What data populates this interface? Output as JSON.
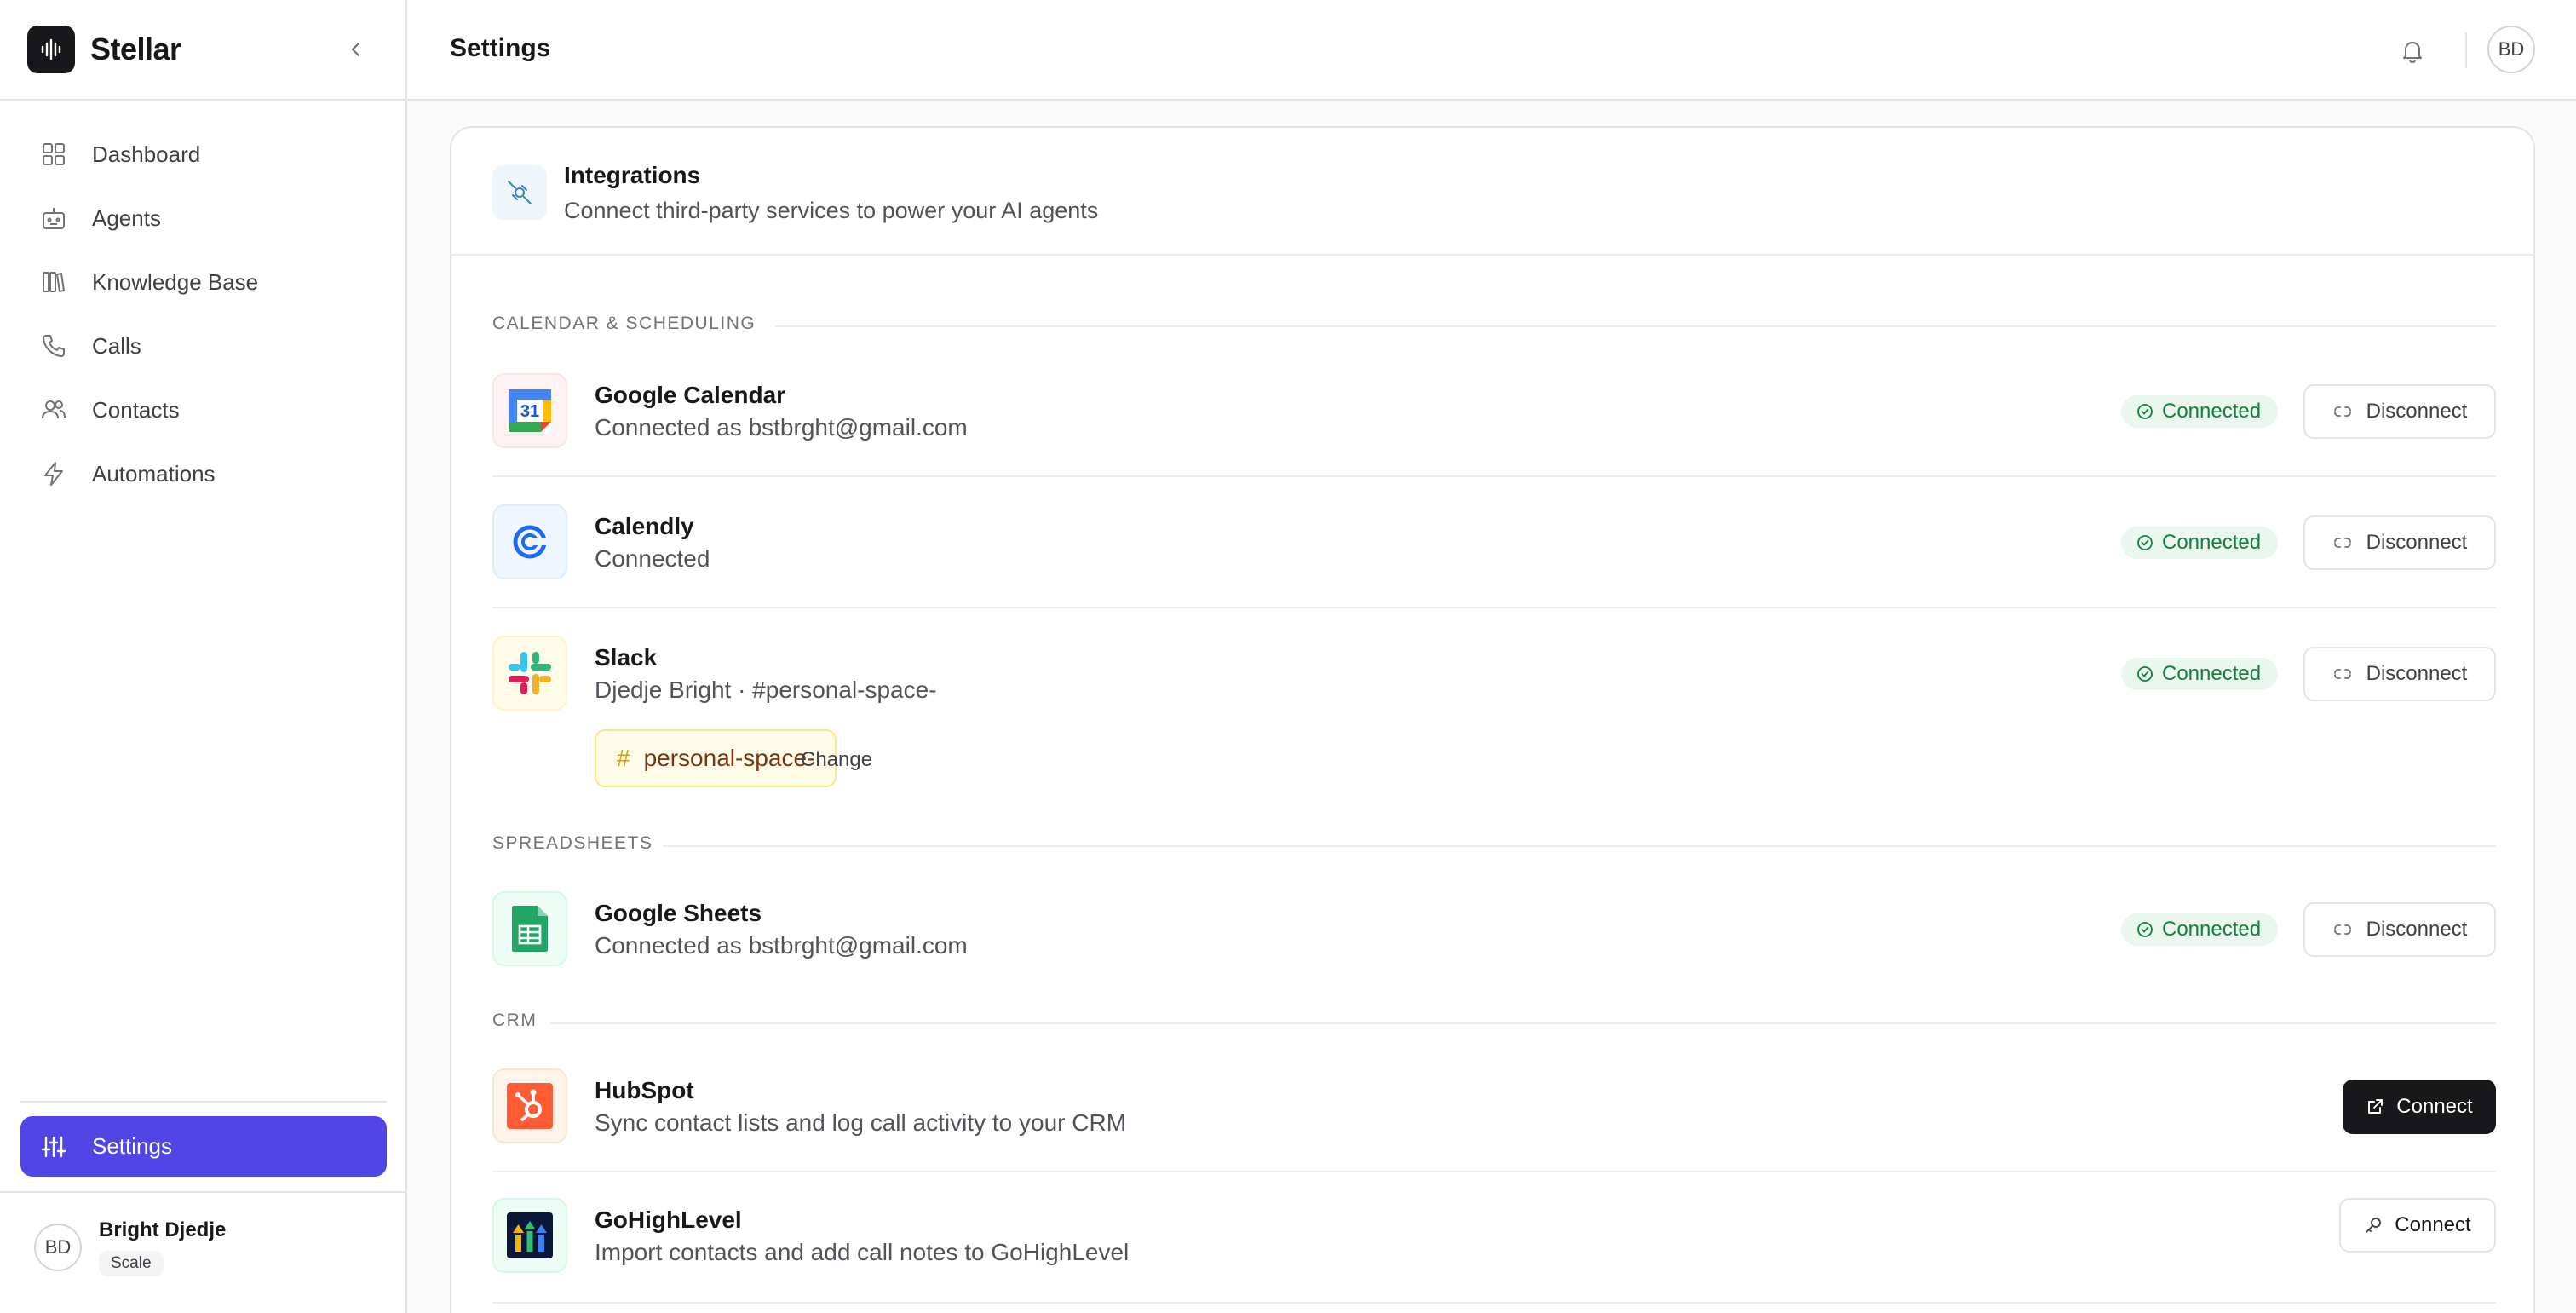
{
  "app": {
    "name": "Stellar"
  },
  "sidebar": {
    "items": [
      {
        "label": "Dashboard",
        "icon": "grid-icon"
      },
      {
        "label": "Agents",
        "icon": "robot-icon"
      },
      {
        "label": "Knowledge Base",
        "icon": "library-icon"
      },
      {
        "label": "Calls",
        "icon": "phone-icon"
      },
      {
        "label": "Contacts",
        "icon": "users-icon"
      },
      {
        "label": "Automations",
        "icon": "zap-icon"
      }
    ],
    "settings": {
      "label": "Settings",
      "icon": "sliders-icon"
    },
    "user": {
      "initials": "BD",
      "name": "Bright Djedje",
      "plan": "Scale"
    }
  },
  "header": {
    "title": "Settings",
    "avatar_initials": "BD"
  },
  "integrations": {
    "title": "Integrations",
    "subtitle": "Connect third-party services to power your AI agents",
    "sections": [
      {
        "label": "CALENDAR & SCHEDULING"
      },
      {
        "label": "SPREADSHEETS"
      },
      {
        "label": "CRM"
      }
    ],
    "apps": [
      {
        "name": "Google Calendar",
        "desc": "Connected as bstbrght@gmail.com",
        "status": "Connected",
        "action": "Disconnect"
      },
      {
        "name": "Calendly",
        "desc": "Connected",
        "status": "Connected",
        "action": "Disconnect"
      },
      {
        "name": "Slack",
        "desc": "Djedje Bright · #personal-space-",
        "status": "Connected",
        "action": "Disconnect",
        "channel": "personal-space-",
        "channel_prefix": "#",
        "change_label": "Change"
      },
      {
        "name": "Google Sheets",
        "desc": "Connected as bstbrght@gmail.com",
        "status": "Connected",
        "action": "Disconnect"
      },
      {
        "name": "HubSpot",
        "desc": "Sync contact lists and log call activity to your CRM",
        "action": "Connect"
      },
      {
        "name": "GoHighLevel",
        "desc": "Import contacts and add call notes to GoHighLevel",
        "action": "Connect"
      }
    ]
  },
  "colors": {
    "accent": "#4f46e5",
    "connected_green": "#15803d",
    "dark_button": "#18181b"
  }
}
